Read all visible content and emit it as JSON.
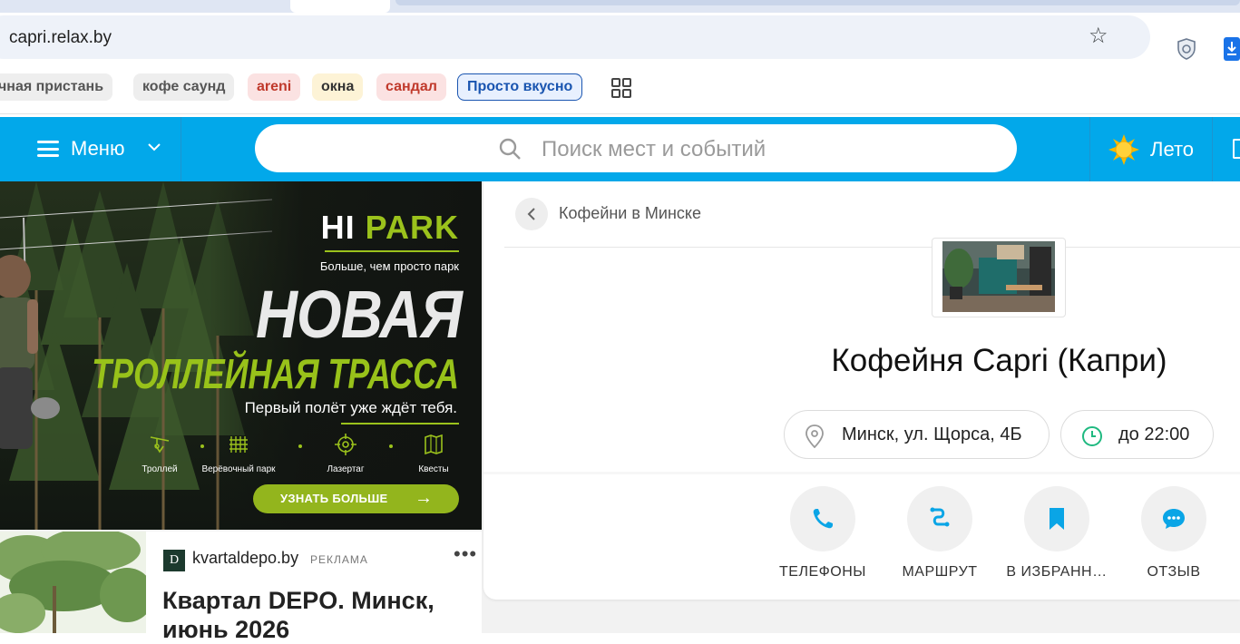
{
  "browser": {
    "url": "capri.relax.by",
    "bookmarks": [
      {
        "label": "чная пристань",
        "bg": "#eeeeee",
        "color": "#555555"
      },
      {
        "label": "кофе саунд",
        "bg": "#eeeeee",
        "color": "#555555"
      },
      {
        "label": "areni",
        "bg": "#fbe2e2",
        "color": "#c0392b"
      },
      {
        "label": "окна",
        "bg": "#fdf3d6",
        "color": "#333333"
      },
      {
        "label": "сандал",
        "bg": "#fbe2e2",
        "color": "#c0392b"
      },
      {
        "label": "Просто вкусно",
        "bg": "#e8f0fe",
        "color": "#1a55b0"
      }
    ]
  },
  "header": {
    "menu_label": "Меню",
    "search_placeholder": "Поиск мест и событий",
    "weather_label": "Лето",
    "accent_color": "#02a8ea"
  },
  "banner": {
    "brand_white": "HI",
    "brand_green": "PARK",
    "tagline": "Больше, чем просто парк",
    "headline1": "НОВАЯ",
    "headline2": "ТРОЛЛЕЙНАЯ ТРАССА",
    "subline": "Первый полёт уже ждёт тебя.",
    "features": [
      {
        "label": "Троллей",
        "icon": "zipline-icon"
      },
      {
        "label": "Верёвочный парк",
        "icon": "rope-net-icon"
      },
      {
        "label": "Лазертаг",
        "icon": "crosshair-icon"
      },
      {
        "label": "Квесты",
        "icon": "map-icon"
      }
    ],
    "cta": "УЗНАТЬ БОЛЬШЕ"
  },
  "ad": {
    "logo_letter": "D",
    "domain": "kvartaldepo.by",
    "label": "РЕКЛАМА",
    "more": "•••",
    "title": "Квартал DEPO. Минск, июнь 2026"
  },
  "place": {
    "breadcrumb": "Кофейни в Минске",
    "title": "Кофейня Capri (Капри)",
    "address": "Минск, ул. Щорса, 4Б",
    "hours": "до 22:00",
    "actions": [
      {
        "label": "ТЕЛЕФОНЫ",
        "icon": "phone-icon"
      },
      {
        "label": "МАРШРУТ",
        "icon": "route-icon"
      },
      {
        "label": "В ИЗБРАНН…",
        "icon": "bookmark-icon"
      },
      {
        "label": "ОТЗЫВ",
        "icon": "chat-icon"
      }
    ]
  }
}
